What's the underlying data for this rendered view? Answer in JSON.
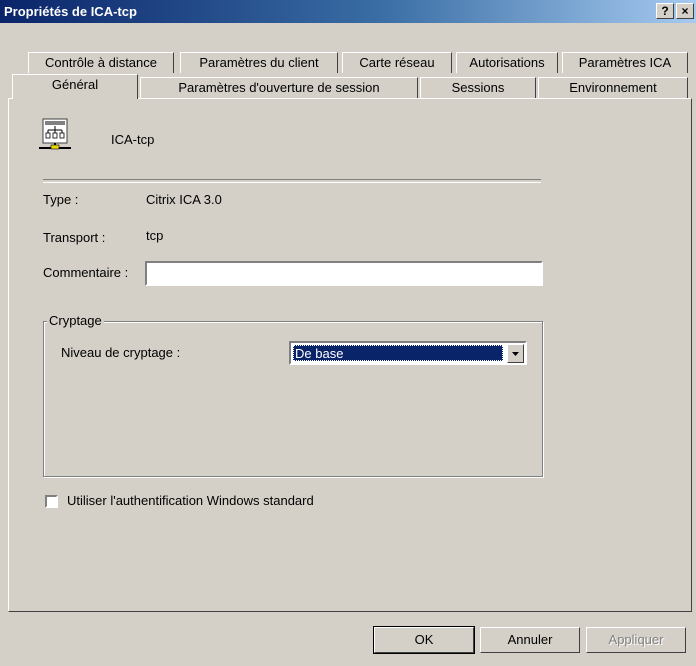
{
  "window": {
    "title": "Propriétés de ICA-tcp",
    "help_button": "?",
    "close_button": "×"
  },
  "tabs_back": [
    {
      "label": "Contrôle à distance"
    },
    {
      "label": "Paramètres du client"
    },
    {
      "label": "Carte réseau"
    },
    {
      "label": "Autorisations"
    },
    {
      "label": "Paramètres ICA"
    }
  ],
  "tabs_front": [
    {
      "label": "Général",
      "active": true
    },
    {
      "label": "Paramètres d'ouverture de session"
    },
    {
      "label": "Sessions"
    },
    {
      "label": "Environnement"
    }
  ],
  "general": {
    "connection_name": "ICA-tcp",
    "type_label": "Type :",
    "type_value": "Citrix ICA 3.0",
    "transport_label": "Transport :",
    "transport_value": "tcp",
    "comment_label": "Commentaire :",
    "comment_value": ""
  },
  "encryption": {
    "group_label": "Cryptage",
    "level_label": "Niveau de cryptage :",
    "level_value": "De base"
  },
  "auth_checkbox": {
    "label": "Utiliser l'authentification Windows standard",
    "checked": false
  },
  "buttons": {
    "ok": "OK",
    "cancel": "Annuler",
    "apply": "Appliquer"
  }
}
